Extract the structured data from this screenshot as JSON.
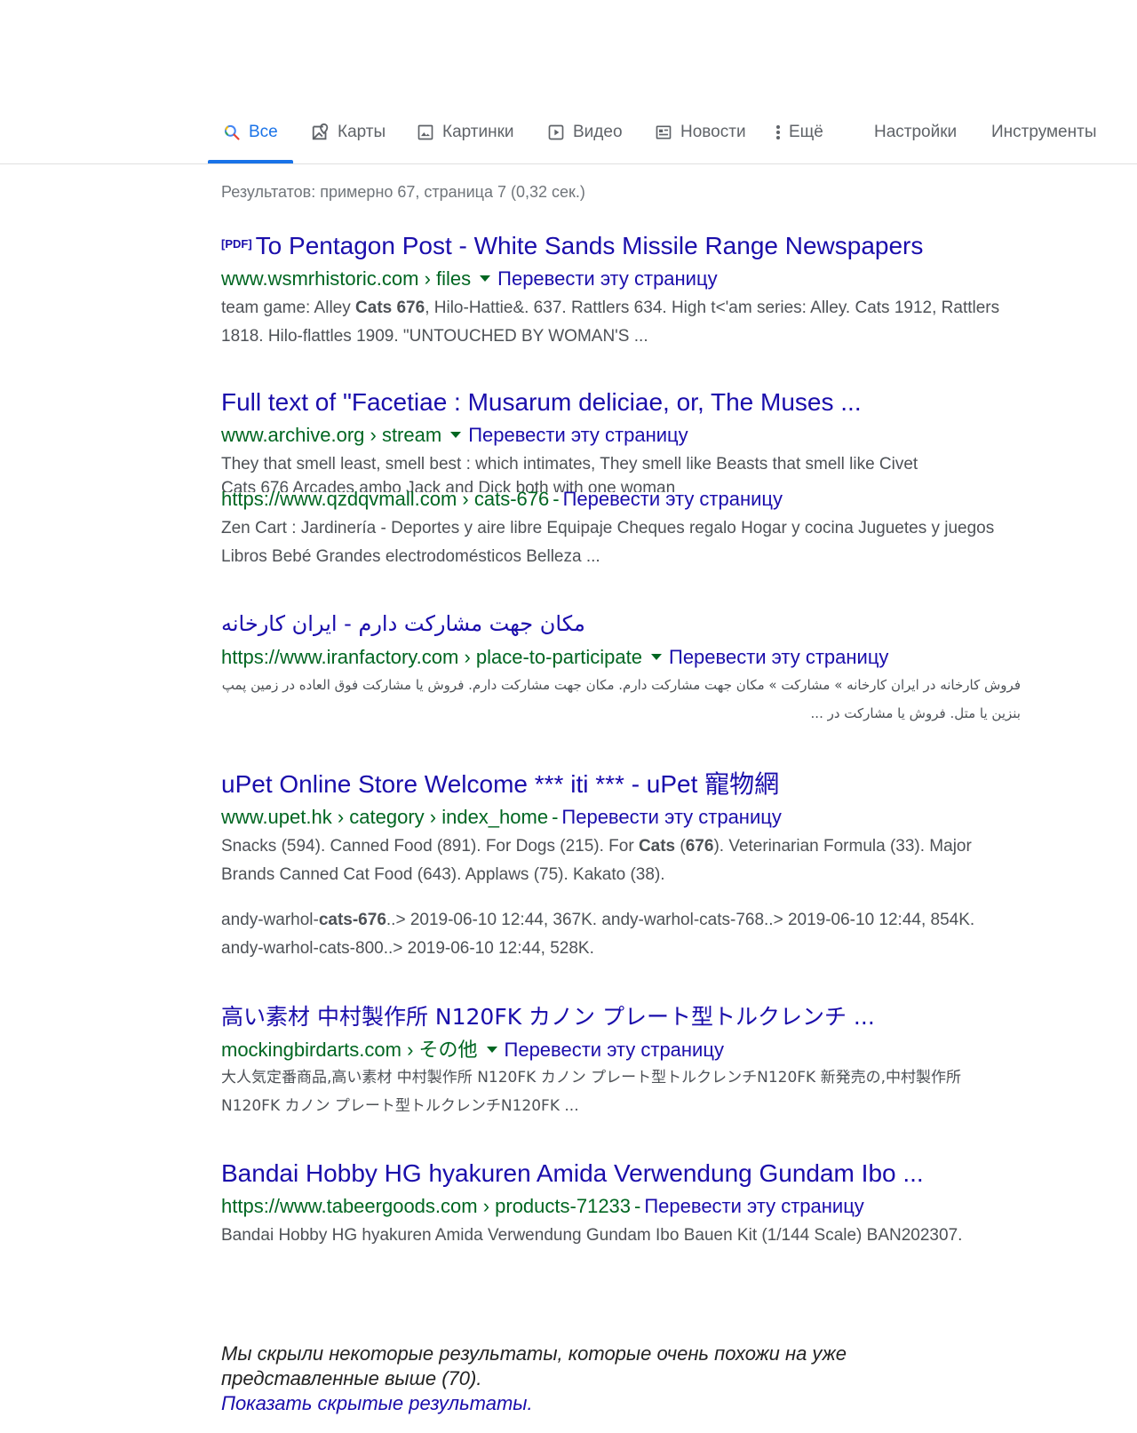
{
  "tabs": [
    {
      "label": "Все",
      "icon": "search-icon"
    },
    {
      "label": "Карты",
      "icon": "map-icon"
    },
    {
      "label": "Картинки",
      "icon": "image-icon"
    },
    {
      "label": "Видео",
      "icon": "video-icon"
    },
    {
      "label": "Новости",
      "icon": "news-icon"
    },
    {
      "label": "Ещё",
      "icon": "more-vert-icon"
    },
    {
      "label": "Настройки"
    },
    {
      "label": "Инструменты"
    }
  ],
  "stats": "Результатов: примерно 67, страница 7 (0,32 сек.)",
  "translate_label": "Перевести эту страницу",
  "results": [
    {
      "badge": "[PDF]",
      "title": "To Pentagon Post - White Sands Missile Range Newspapers",
      "url": "www.wsmrhistoric.com › files",
      "snippet_pre1": "team game: Alley ",
      "snippet_b1": "Cats 676",
      "snippet_post1": ", Hilo-Hattie&. 637. Rattlers 634. High t<'am series: Alley. Cats 1912, Rattlers 1818. Hilo-flattles 1909. \"UNTOUCHED BY WOMAN'S ..."
    },
    {
      "title": "Full text of \"Facetiae : Musarum deliciae, or, The Muses ...",
      "url": "www.archive.org › stream",
      "snippet": "They that smell least, smell best : which intimates, They smell like Beasts that smell like Civet",
      "snippet_line2": "Cats 676 Arcades ambo Jack and Dick both with one woman"
    },
    {
      "url": "https://www.qzdqvmall.com › cats-676",
      "snippet": "Zen Cart : Jardinería - Deportes y aire libre Equipaje Cheques regalo Hogar y cocina Juguetes y juegos Libros Bebé Grandes electrodomésticos Belleza ..."
    },
    {
      "title": "مکان جهت مشارکت دارم - ایران کارخانه",
      "url": "https://www.iranfactory.com › place-to-participate",
      "snippet": "فروش کارخانه در ایران کارخانه » مشارکت » مکان جهت مشارکت دارم. مکان جهت مشارکت دارم. فروش یا مشارکت فوق العاده در زمین پمپ بنزین یا متل. فروش یا مشارکت در ..."
    },
    {
      "title": "uPet Online Store Welcome *** iti *** - uPet 寵物網",
      "url": "www.upet.hk › category › index_home",
      "snippet_pre": "Snacks (594). Canned Food (891). For Dogs (215). For ",
      "snippet_b": "Cats",
      "snippet_mid": " (",
      "snippet_b2": "676",
      "snippet_post": "). Veterinarian Formula (33). Major Brands Canned Cat Food (643). Applaws (75). Kakato (38)."
    },
    {
      "snippet_pre": "andy-warhol-",
      "snippet_b": "cats-676",
      "snippet_post": "..> 2019-06-10 12:44, 367K. andy-warhol-cats-768..> 2019-06-10 12:44, 854K. andy-warhol-cats-800..> 2019-06-10 12:44, 528K."
    },
    {
      "title": "高い素材 中村製作所 N120FK カノン プレート型トルクレンチ ...",
      "url": "mockingbirdarts.com › その他",
      "snippet": "大人気定番商品,高い素材 中村製作所 N120FK カノン プレート型トルクレンチN120FK 新発売の,中村製作所 N120FK カノン プレート型トルクレンチN120FK ..."
    },
    {
      "title": "Bandai Hobby HG hyakuren Amida Verwendung Gundam Ibo ...",
      "url": "https://www.tabeergoods.com › products-71233",
      "snippet": "Bandai Hobby HG hyakuren Amida Verwendung Gundam Ibo Bauen Kit (1/144 Scale) BAN202307."
    }
  ],
  "hidden_note": "Мы скрыли некоторые результаты, которые очень похожи на уже представленные выше (70).",
  "show_hidden_link": "Показать скрытые результаты."
}
